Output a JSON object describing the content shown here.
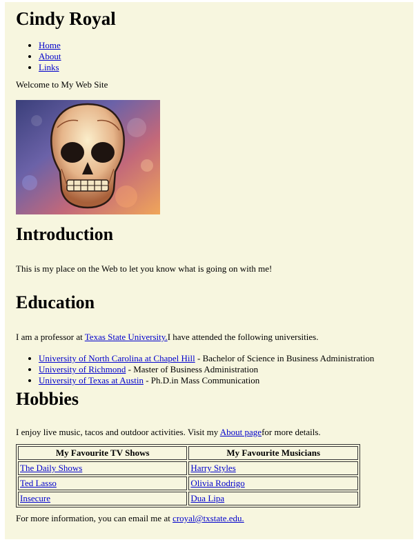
{
  "site": {
    "title": "Cindy Royal"
  },
  "nav": {
    "items": [
      "Home",
      "About",
      "Links"
    ]
  },
  "welcome": "Welcome to My Web Site",
  "introduction": {
    "heading": "Introduction",
    "text": "This is my place on the Web to let you know what is going on with me!"
  },
  "education": {
    "heading": "Education",
    "text_before": "I am a professor at ",
    "link": "Texas State University.",
    "text_after": "I have attended the following universities.",
    "schools": [
      {
        "name": "University of North Carolina at Chapel Hill",
        "degree": " - Bachelor of Science in Business Administration"
      },
      {
        "name": "University of Richmond",
        "degree": " - Master of Business Administration"
      },
      {
        "name": "University of Texas at Austin",
        "degree": " - Ph.D.in Mass Communication"
      }
    ]
  },
  "hobbies": {
    "heading": "Hobbies",
    "text_before": "I enjoy live music, tacos and outdoor activities. Visit my ",
    "link": "About page",
    "text_after": "for more details."
  },
  "table": {
    "headers": [
      "My Favourite TV Shows",
      "My Favourite Musicians"
    ],
    "rows": [
      [
        "The Daily Shows",
        "Harry Styles"
      ],
      [
        "Ted Lasso",
        "Olivia Rodrigo"
      ],
      [
        "Insecure",
        "Dua Lipa"
      ]
    ]
  },
  "contact": {
    "text": "For more information, you can email me at ",
    "email": "croyal@txstate.edu."
  },
  "image": {
    "subject": "skull-illustration",
    "colors": [
      "#6a6fb0",
      "#e07a5a",
      "#2a2a44"
    ]
  }
}
